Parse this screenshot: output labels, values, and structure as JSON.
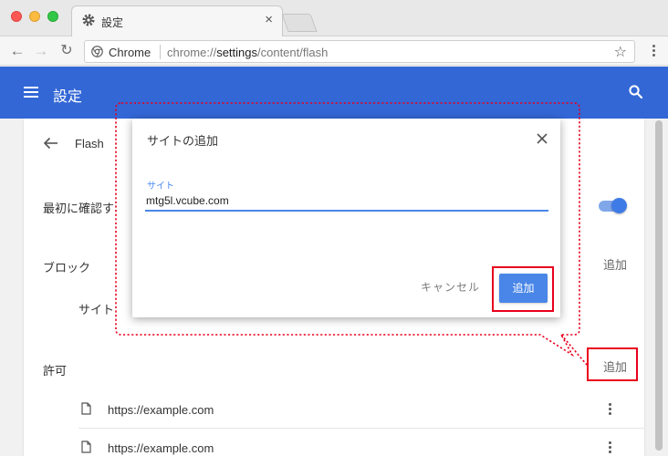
{
  "browser": {
    "tab_title": "設定",
    "tab_close": "×",
    "url_scheme_label": "Chrome",
    "url_prefix": "chrome://",
    "url_host": "settings",
    "url_path": "/content/flash",
    "bookmark_star": "☆"
  },
  "header": {
    "title": "設定"
  },
  "flash_page": {
    "title": "Flash",
    "ask_first": "最初に確認す",
    "ask_first_enabled": true,
    "block_section": {
      "label": "ブロック",
      "add": "追加",
      "empty_site_label": "サイト"
    },
    "allow_section": {
      "label": "許可",
      "add": "追加",
      "sites": [
        "https://example.com",
        "https://example.com"
      ]
    }
  },
  "dialog": {
    "title": "サイトの追加",
    "field_label": "サイト",
    "field_value": "mtg5l.vcube.com",
    "cancel_label": "キャンセル",
    "add_label": "追加"
  },
  "colors": {
    "header_blue": "#3367d6",
    "accent_blue": "#4a86e8",
    "highlight_red": "#e8001d"
  }
}
